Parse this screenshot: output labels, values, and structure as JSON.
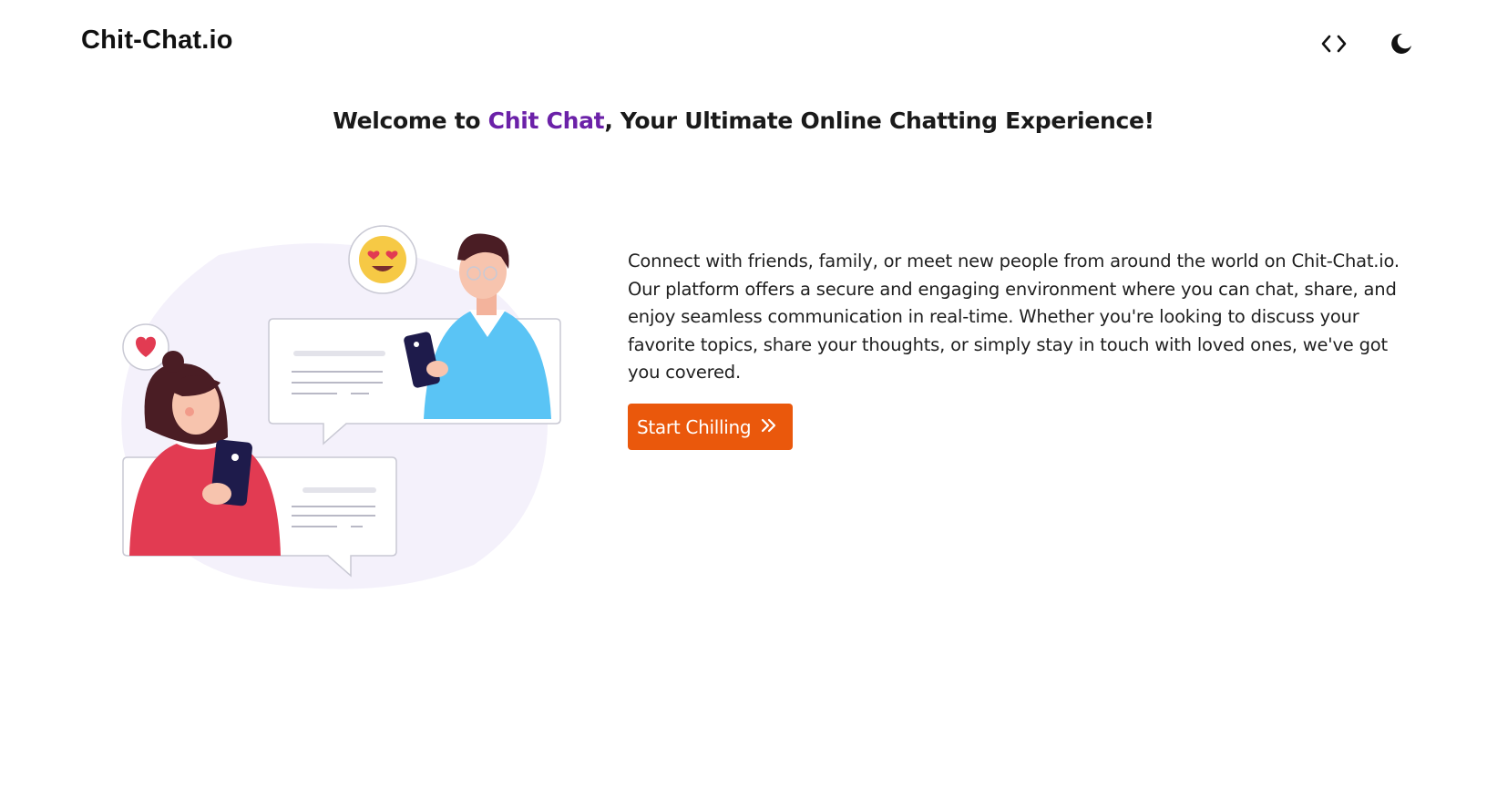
{
  "nav": {
    "brand": "Chit-Chat.io",
    "icons": {
      "code": "code-icon",
      "theme": "moon-icon"
    }
  },
  "hero": {
    "headline_prefix": "Welcome to ",
    "headline_accent": "Chit Chat",
    "headline_suffix": ", Your Ultimate Online Chatting Experience!",
    "description": "Connect with friends, family, or meet new people from around the world on Chit-Chat.io. Our platform offers a secure and engaging environment where you can chat, share, and enjoy seamless communication in real-time. Whether you're looking to discuss your favorite topics, share your thoughts, or simply stay in touch with loved ones, we've got you covered.",
    "cta_label": "Start Chilling",
    "cta_icon": "double-chevron-right-icon"
  },
  "colors": {
    "accent_purple": "#6b21a8",
    "cta_orange": "#ea580c",
    "shirt_blue": "#5ac4f5",
    "shirt_red": "#e23b52"
  }
}
